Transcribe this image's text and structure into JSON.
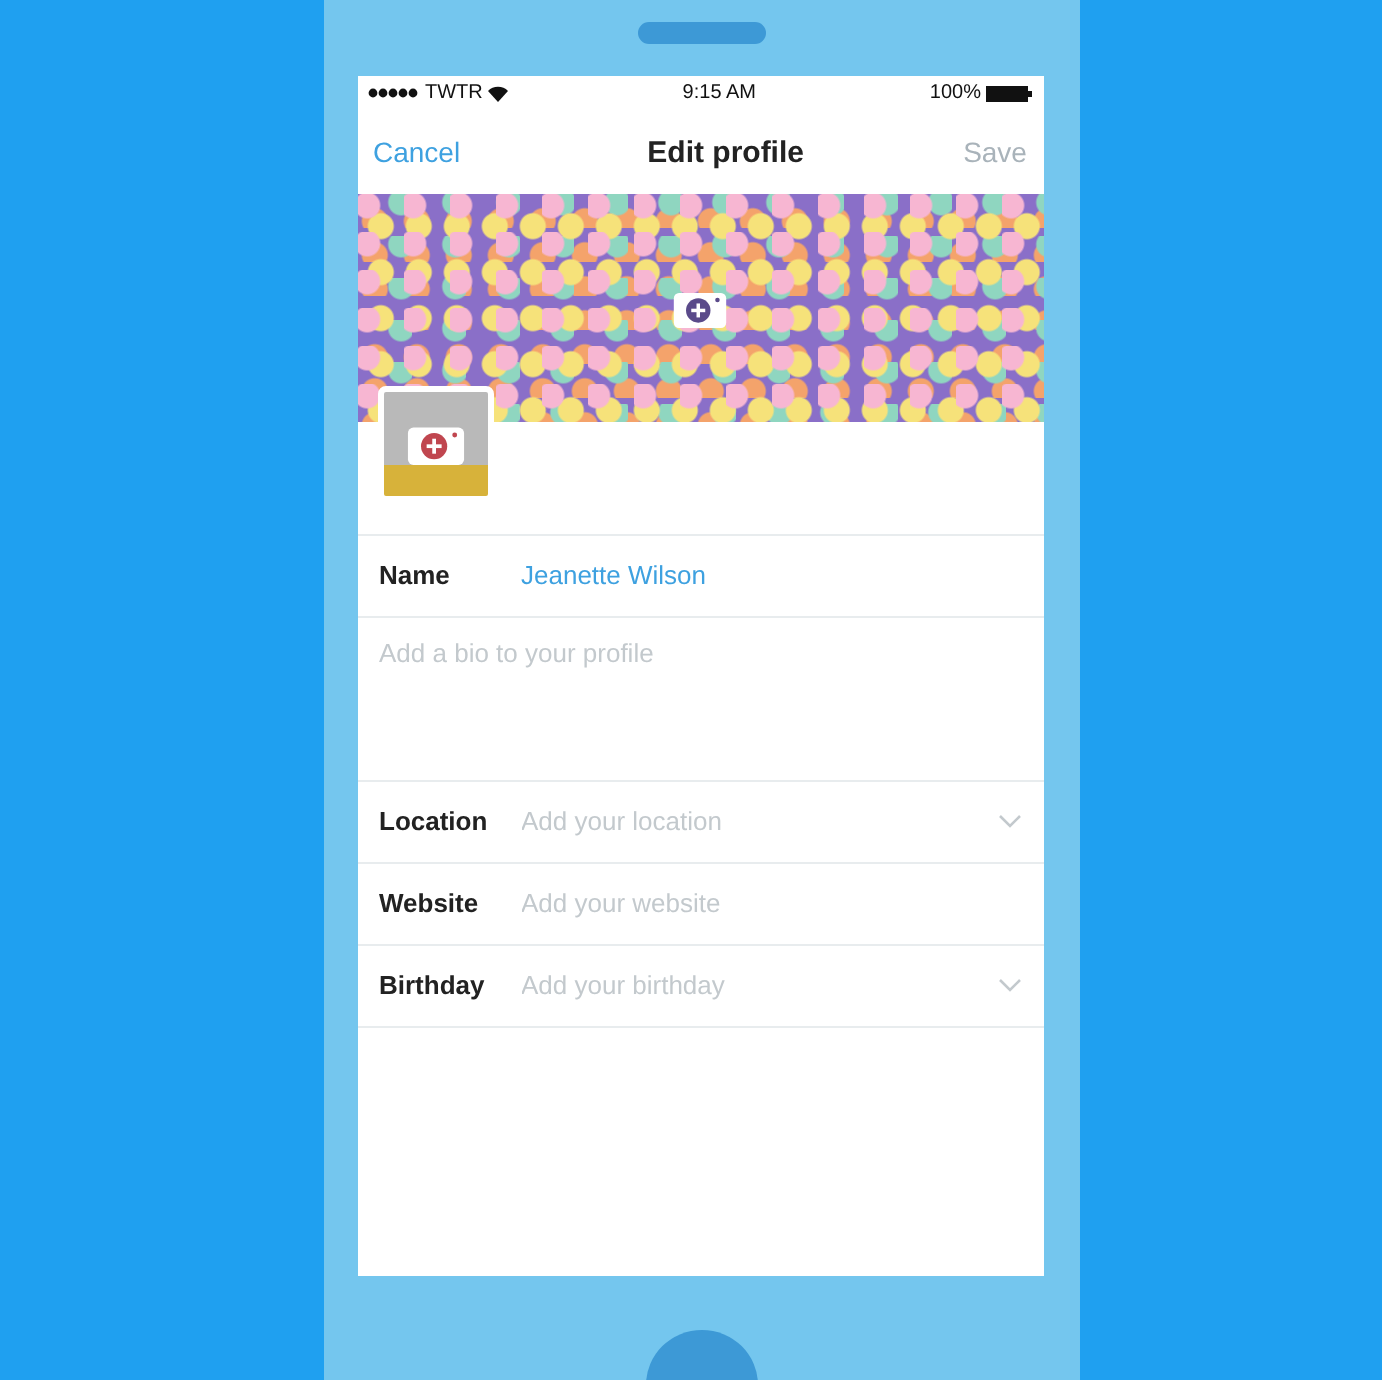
{
  "status_bar": {
    "carrier": "TWTR",
    "time": "9:15 AM",
    "battery": "100%"
  },
  "nav": {
    "cancel": "Cancel",
    "title": "Edit profile",
    "save": {
      "label": "Save",
      "disabled": true
    }
  },
  "name_field": {
    "label": "Name",
    "value": "Jeanette Wilson"
  },
  "bio_field": {
    "placeholder": "Add a bio to your profile"
  },
  "fields": [
    {
      "label": "Location",
      "placeholder": "Add your location",
      "dropdown": true
    },
    {
      "label": "Website",
      "placeholder": "Add your website",
      "dropdown": false
    },
    {
      "label": "Birthday",
      "placeholder": "Add your birthday",
      "dropdown": true
    }
  ]
}
